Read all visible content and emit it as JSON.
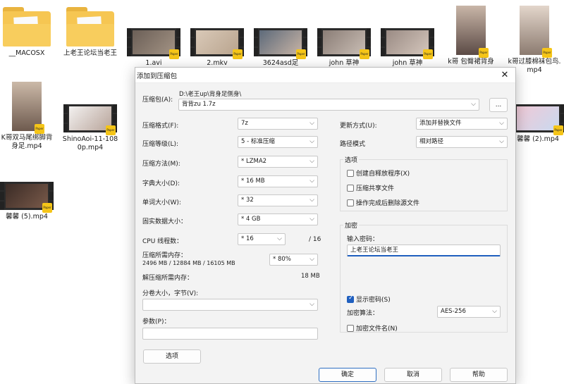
{
  "desktop": {
    "items": [
      {
        "label": "__MACOSX",
        "kind": "folder"
      },
      {
        "label": "上老王论坛当老王",
        "kind": "folder"
      },
      {
        "label": "1.avi",
        "kind": "video"
      },
      {
        "label": "2.mkv",
        "kind": "video"
      },
      {
        "label": "3624asd足",
        "kind": "video"
      },
      {
        "label": "john 草神",
        "kind": "video"
      },
      {
        "label": "john 草神",
        "kind": "video"
      },
      {
        "label": "k哥 包臀裙背身",
        "kind": "photo"
      },
      {
        "label": "k哥过膝棉袜包鸟.mp4",
        "kind": "photo"
      },
      {
        "label": "K哥双马尾绑脚背身足.mp4",
        "kind": "photo"
      },
      {
        "label": "ShinoAoi-11-1080p.mp4",
        "kind": "video"
      },
      {
        "label": "馨馨 (2).mp4",
        "kind": "video"
      },
      {
        "label": "馨馨 (5).mp4",
        "kind": "video"
      }
    ],
    "badge_text": "Paper"
  },
  "dialog": {
    "title": "添加到压缩包",
    "archive_label": "压缩包(A):",
    "archive_path": "D:\\老王up\\背身足侧身\\",
    "archive_name": "背背zu 1.7z",
    "browse_label": "...",
    "format_label": "压缩格式(F):",
    "format_value": "7z",
    "level_label": "压缩等级(L):",
    "level_value": "5 - 标准压缩",
    "method_label": "压缩方法(M):",
    "method_value": "* LZMA2",
    "dict_label": "字典大小(D):",
    "dict_value": "* 16 MB",
    "word_label": "单词大小(W):",
    "word_value": "* 32",
    "solid_label": "固实数据大小：",
    "solid_value": "* 4 GB",
    "cpu_label": "CPU 线程数：",
    "cpu_value": "* 16",
    "cpu_total": "/ 16",
    "mem_label": "压缩所需内存：",
    "mem_detail": "2496 MB / 12884 MB / 16105 MB",
    "mem_pct": "* 80%",
    "decomp_label": "解压缩所需内存：",
    "decomp_value": "18 MB",
    "split_label": "分卷大小，字节(V):",
    "split_value": "",
    "params_label": "参数(P)：",
    "params_value": "",
    "options_btn": "选项",
    "update_label": "更新方式(U):",
    "update_value": "添加并替换文件",
    "path_label": "路径模式",
    "path_value": "相对路径",
    "options_group": "选项",
    "opt_sfx": "创建自释放程序(X)",
    "opt_shared": "压缩共享文件",
    "opt_delete": "操作完成后删除源文件",
    "enc_group": "加密",
    "pwd_label": "输入密码：",
    "pwd_value": "上老王论坛当老王",
    "show_pwd": "显示密码(S)",
    "enc_method_label": "加密算法：",
    "enc_method_value": "AES-256",
    "enc_names": "加密文件名(N)",
    "ok": "确定",
    "cancel": "取消",
    "help": "帮助"
  }
}
